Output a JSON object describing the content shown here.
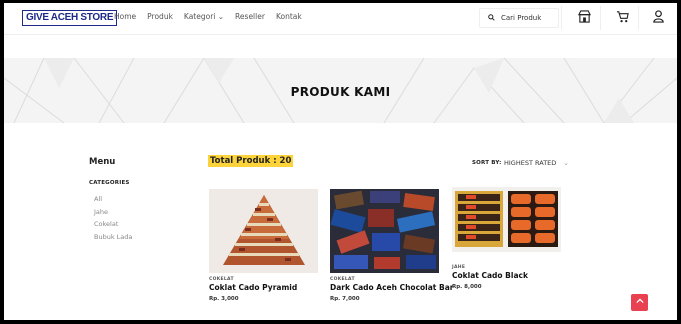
{
  "header": {
    "logo_text": "GIVE ACEH STORE",
    "nav": [
      {
        "label": "Home"
      },
      {
        "label": "Produk"
      },
      {
        "label": "Kategori ⌄"
      },
      {
        "label": "Reseller"
      },
      {
        "label": "Kontak"
      }
    ],
    "search_placeholder": "Cari Produk",
    "icons": [
      "search-icon",
      "shop-icon",
      "cart-icon",
      "user-icon"
    ]
  },
  "banner": {
    "title": "PRODUK KAMI"
  },
  "sidebar": {
    "title": "Menu",
    "categories_title": "CATEGORIES",
    "categories": [
      {
        "label": "All"
      },
      {
        "label": "Jahe"
      },
      {
        "label": "Cokelat"
      },
      {
        "label": "Bubuk Lada"
      }
    ]
  },
  "products_header": {
    "total": "Total Produk : 20",
    "sort_label": "SORT BY:",
    "sort_value": "HIGHEST RATED"
  },
  "products": [
    {
      "category": "COKELAT",
      "name": "Coklat Cado Pyramid",
      "price": "Rp. 3,000"
    },
    {
      "category": "COKELAT",
      "name": "Dark Cado Aceh Chocolat Bar",
      "price": "Rp. 7,000"
    },
    {
      "category": "JAHE",
      "name": "Coklat Cado Black",
      "price": "Rp. 8,000"
    }
  ],
  "colors": {
    "accent": "#fcd33a",
    "to_top": "#e84152",
    "logo": "#1d2a8a"
  }
}
